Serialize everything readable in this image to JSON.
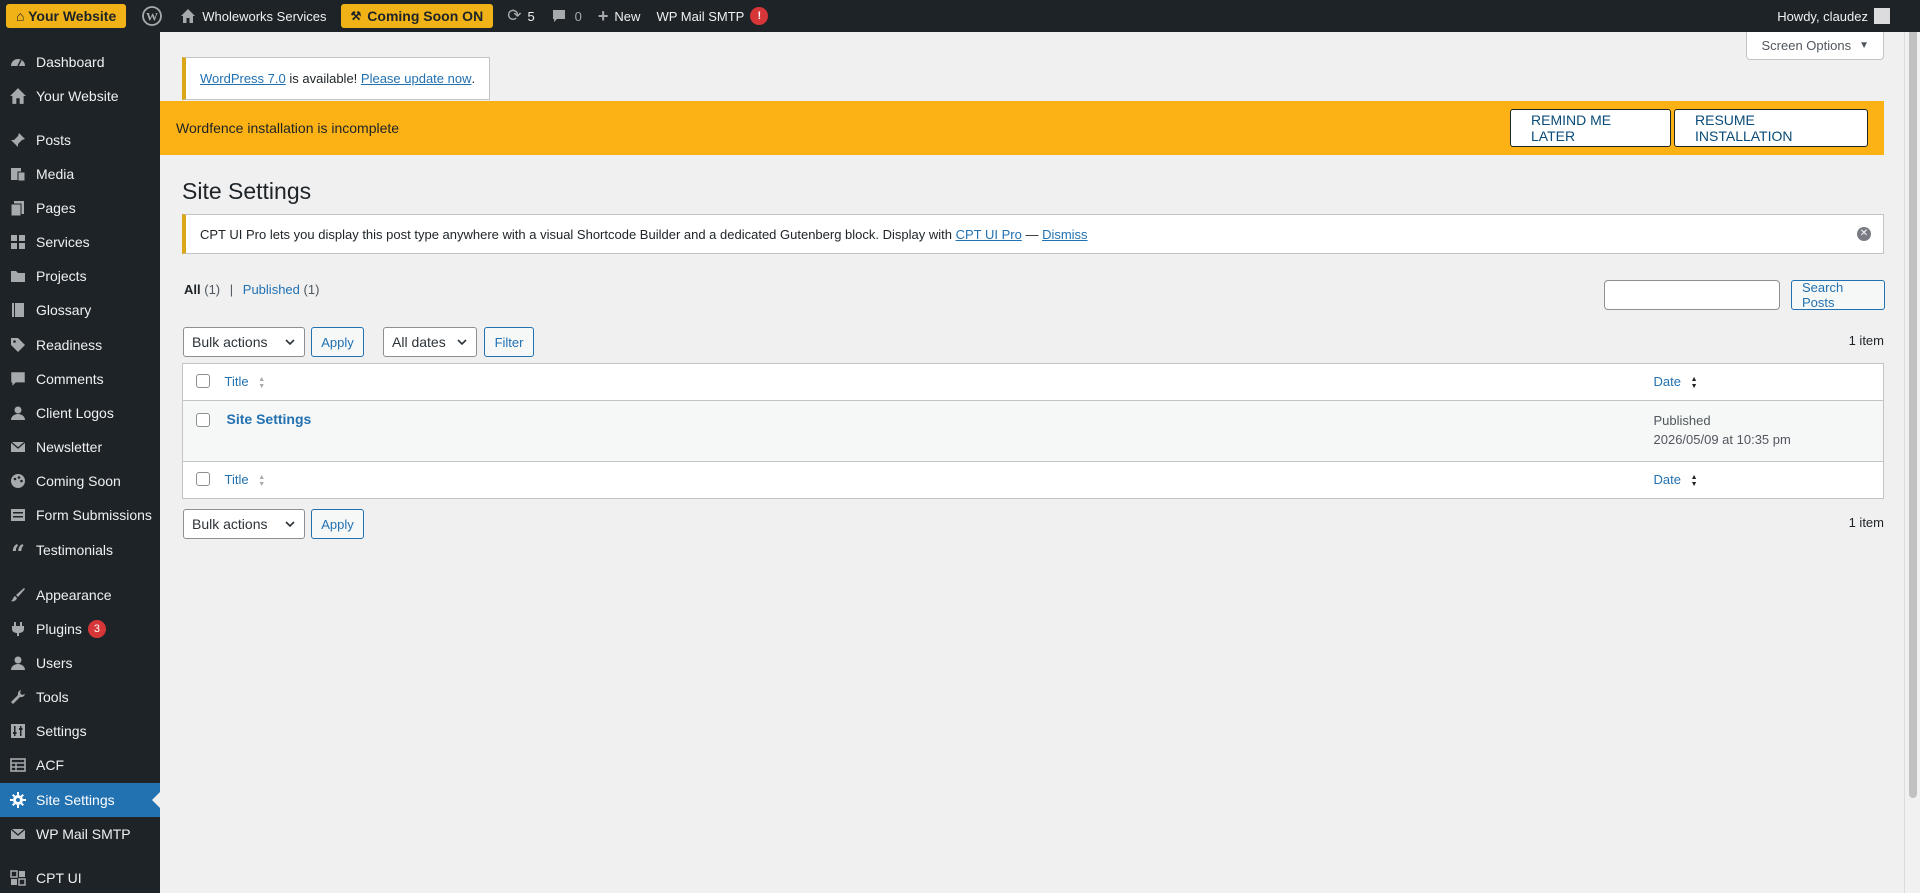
{
  "adminbar": {
    "your_website": "⌂ Your Website",
    "site_name": "Wholeworks Services",
    "coming_soon": "Coming Soon ON",
    "updates_count": "5",
    "comments_count": "0",
    "new_label": "New",
    "wp_mail_smtp": "WP Mail SMTP",
    "smtp_alert": "!",
    "howdy": "Howdy, claudez"
  },
  "sidebar": {
    "items": [
      {
        "label": "Dashboard"
      },
      {
        "label": "Your Website"
      },
      {
        "label": "Posts"
      },
      {
        "label": "Media"
      },
      {
        "label": "Pages"
      },
      {
        "label": "Services"
      },
      {
        "label": "Projects"
      },
      {
        "label": "Glossary"
      },
      {
        "label": "Readiness"
      },
      {
        "label": "Comments"
      },
      {
        "label": "Client Logos"
      },
      {
        "label": "Newsletter"
      },
      {
        "label": "Coming Soon"
      },
      {
        "label": "Form Submissions"
      },
      {
        "label": "Testimonials"
      },
      {
        "label": "Appearance"
      },
      {
        "label": "Plugins",
        "badge": "3"
      },
      {
        "label": "Users"
      },
      {
        "label": "Tools"
      },
      {
        "label": "Settings"
      },
      {
        "label": "ACF"
      },
      {
        "label": "Site Settings"
      },
      {
        "label": "WP Mail SMTP"
      },
      {
        "label": "CPT UI"
      }
    ]
  },
  "screen_options": "Screen Options",
  "update_nag": {
    "version_link": "WordPress 7.0",
    "middle_text": " is available! ",
    "update_link": "Please update now",
    "end": "."
  },
  "wordfence": {
    "message": "Wordfence installation is incomplete",
    "remind": "REMIND ME LATER",
    "resume": "RESUME INSTALLATION"
  },
  "page_title": "Site Settings",
  "cpt_notice": {
    "text": "CPT UI Pro lets you display this post type anywhere with a visual Shortcode Builder and a dedicated Gutenberg block. Display with ",
    "link": "CPT UI Pro",
    "dash": " — ",
    "dismiss": "Dismiss"
  },
  "filters": {
    "all_label": "All",
    "all_count": "(1)",
    "separator": "|",
    "published_label": "Published",
    "published_count": "(1)"
  },
  "search_button": "Search Posts",
  "bulk_actions": "Bulk actions",
  "apply": "Apply",
  "all_dates": "All dates",
  "filter": "Filter",
  "items_count": "1 item",
  "table": {
    "col_title": "Title",
    "col_date": "Date",
    "rows": [
      {
        "title": "Site Settings",
        "status": "Published",
        "date": "2026/05/09 at 10:35 pm"
      }
    ]
  }
}
